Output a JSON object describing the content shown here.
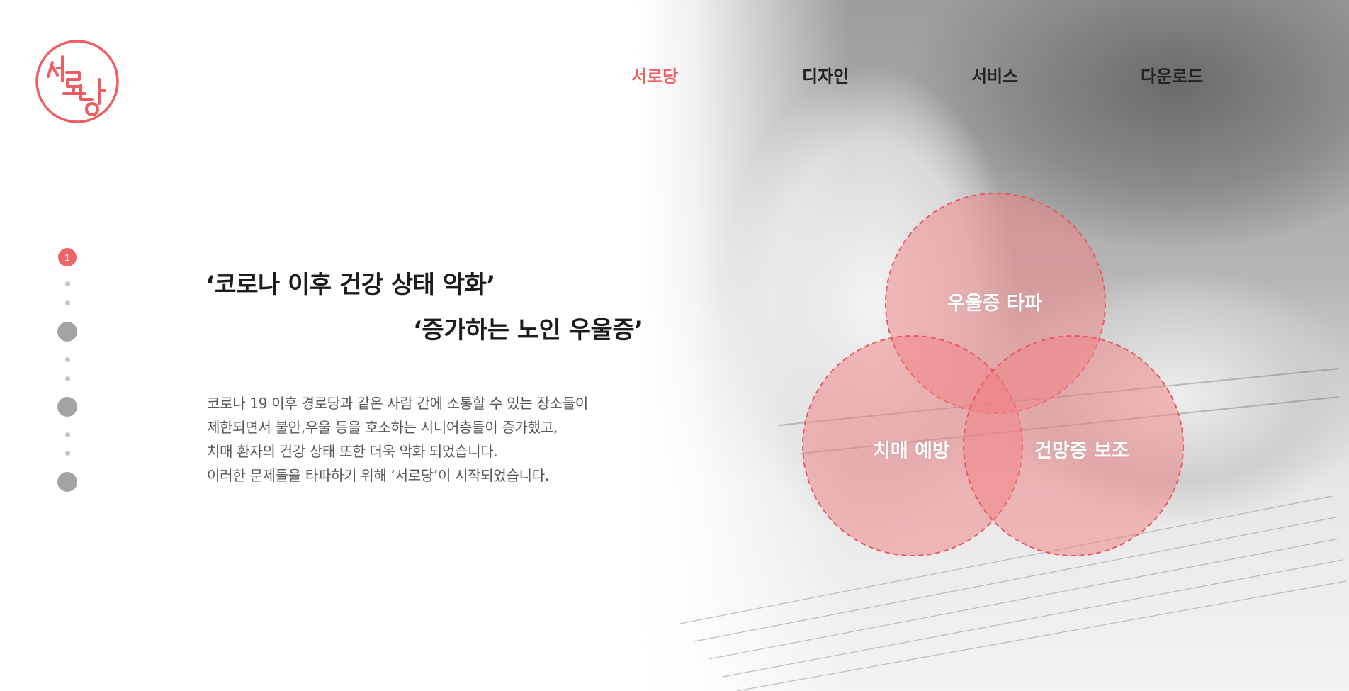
{
  "brand": {
    "logo_text": "서로당",
    "accent_color": "#ee5d61"
  },
  "nav": {
    "items": [
      {
        "label": "서로당",
        "active": true
      },
      {
        "label": "디자인",
        "active": false
      },
      {
        "label": "서비스",
        "active": false
      },
      {
        "label": "다운로드",
        "active": false
      }
    ]
  },
  "pager": {
    "current_page": "1",
    "total_pages": 4
  },
  "main": {
    "headline_1": "‘코로나 이후 건강 상태 악화’",
    "headline_2": "‘증가하는 노인 우울증’",
    "body_lines": [
      "코로나 19 이후 경로당과 같은 사람 간에 소통할 수 있는 장소들이",
      "제한되면서 불안,우울 등을 호소하는 시니어층들이 증가했고,",
      "치매 환자의 건강 상태 또한 더욱 악화 되었습니다.",
      "이러한 문제들을 타파하기 위해 ‘서로당’이 시작되었습니다."
    ]
  },
  "venn": {
    "top_label": "우울증 타파",
    "left_label": "치매 예방",
    "right_label": "건망증 보조",
    "circle_color": "#f28a8d"
  }
}
